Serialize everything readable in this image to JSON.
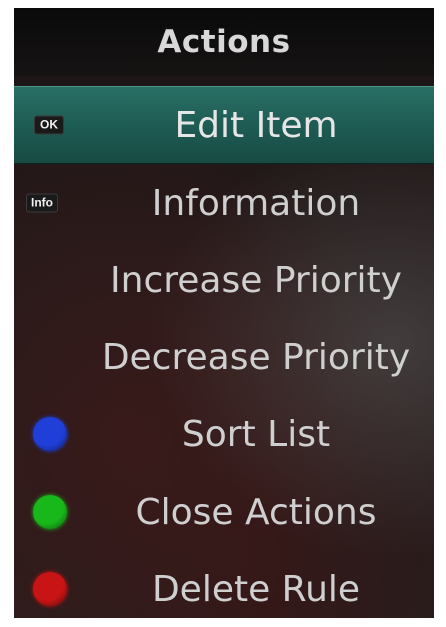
{
  "menu": {
    "title": "Actions",
    "items": [
      {
        "label": "Edit Item",
        "key": "OK",
        "key_type": "badge",
        "selected": true
      },
      {
        "label": "Information",
        "key": "Info",
        "key_type": "badge",
        "selected": false
      },
      {
        "label": "Increase Priority",
        "key_type": "none",
        "selected": false
      },
      {
        "label": "Decrease Priority",
        "key_type": "none",
        "selected": false
      },
      {
        "label": "Sort List",
        "key_type": "color",
        "color_name": "blue-button-icon",
        "color": "#1f3fd8",
        "selected": false
      },
      {
        "label": "Close Actions",
        "key_type": "color",
        "color_name": "green-button-icon",
        "color": "#18b81a",
        "selected": false
      },
      {
        "label": "Delete Rule",
        "key_type": "color",
        "color_name": "red-button-icon",
        "color": "#c81414",
        "selected": false
      }
    ]
  }
}
